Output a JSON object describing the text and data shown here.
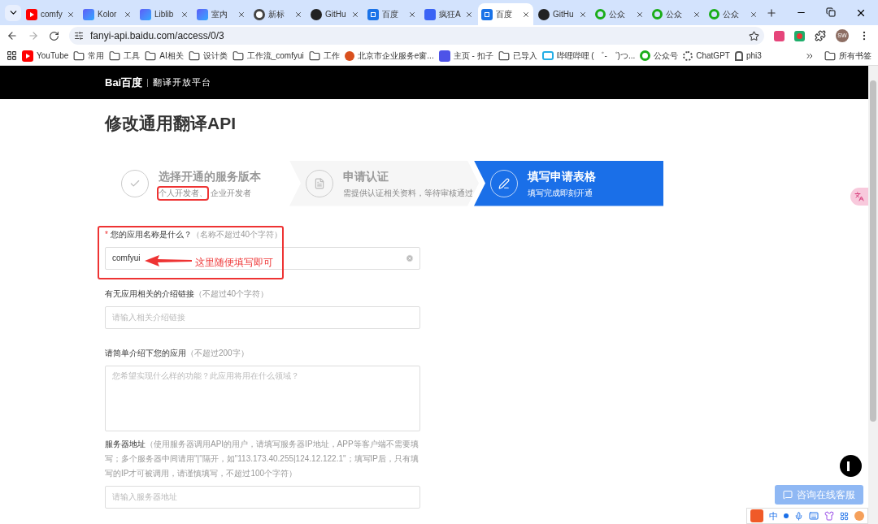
{
  "tabs": [
    {
      "kind": "youtube",
      "title": "comfy",
      "selected": false
    },
    {
      "kind": "ub",
      "title": "Kolor",
      "selected": false
    },
    {
      "kind": "ub",
      "title": "Liblib",
      "selected": false
    },
    {
      "kind": "ub",
      "title": "室内",
      "selected": false
    },
    {
      "kind": "chrome",
      "title": "新标",
      "selected": false
    },
    {
      "kind": "github",
      "title": "GitHu",
      "selected": false
    },
    {
      "kind": "translate",
      "title": "百度",
      "selected": false
    },
    {
      "kind": "kuang",
      "title": "疯狂A",
      "selected": false
    },
    {
      "kind": "translate",
      "title": "百度",
      "selected": true
    },
    {
      "kind": "github",
      "title": "GitHu",
      "selected": false
    },
    {
      "kind": "wechat",
      "title": "公众",
      "selected": false
    },
    {
      "kind": "wechat",
      "title": "公众",
      "selected": false
    },
    {
      "kind": "wechat",
      "title": "公众",
      "selected": false
    }
  ],
  "address": "fanyi-api.baidu.com/access/0/3",
  "profile": "SW",
  "bookmarks": [
    {
      "kind": "youtube",
      "label": "YouTube"
    },
    {
      "kind": "folder",
      "label": "常用"
    },
    {
      "kind": "folder",
      "label": "工具"
    },
    {
      "kind": "folder",
      "label": "AI相关"
    },
    {
      "kind": "folder",
      "label": "设计类"
    },
    {
      "kind": "folder",
      "label": "工作流_comfyui"
    },
    {
      "kind": "folder",
      "label": "工作"
    },
    {
      "kind": "gov",
      "label": "北京市企业服务e窗..."
    },
    {
      "kind": "kouzi",
      "label": "主页 - 扣子"
    },
    {
      "kind": "folder",
      "label": "已导入"
    },
    {
      "kind": "bili",
      "label": "哔哩哔哩 ( ゜- ゜)つ..."
    },
    {
      "kind": "wechat",
      "label": "公众号"
    },
    {
      "kind": "gpt",
      "label": "ChatGPT"
    },
    {
      "kind": "robot",
      "label": "phi3"
    }
  ],
  "all_bookmarks": "所有书签",
  "site": {
    "logo": "Bai百度",
    "platform": "翻译开放平台"
  },
  "page_title": "修改通用翻译API",
  "steps": [
    {
      "kind": "check",
      "title": "选择开通的服务版本",
      "subtitle": [
        {
          "text": "个人开发者、",
          "highlighted": true
        },
        {
          "text": "企业开发者",
          "highlighted": false
        }
      ],
      "selected": false
    },
    {
      "kind": "doc",
      "title": "申请认证",
      "subtitle": [
        {
          "text": "需提供认证相关资料，等待审核通过",
          "highlighted": false
        }
      ],
      "selected": false
    },
    {
      "kind": "pen",
      "title": "填写申请表格",
      "subtitle": [
        {
          "text": "填写完成即刻开通",
          "highlighted": false
        }
      ],
      "selected": true
    }
  ],
  "fields": [
    {
      "marker": "*",
      "label": "您的应用名称是什么？",
      "hint": "（名称不超过40个字符）",
      "kind": "input",
      "value": "comfyui"
    },
    {
      "label": "有无应用相关的介绍链接",
      "hint": "（不超过40个字符）",
      "kind": "input",
      "placeholder": "请输入相关介绍链接"
    },
    {
      "label": "请简单介绍下您的应用",
      "hint": "（不超过200字）",
      "kind": "textarea",
      "placeholder": "您希望实现什么样的功能？此应用将用在什么领域？"
    },
    {
      "label": "服务器地址",
      "hint": "（使用服务器调用API的用户，请填写服务器IP地址，APP等客户端不需要填写；多个服务器中间请用\"|\"隔开，如\"113.173.40.255|124.12.122.1\"；填写IP后，只有填写的IP才可被调用，请谨慎填写，不超过100个字符）",
      "kind": "input",
      "placeholder": "请输入服务器地址"
    }
  ],
  "annotation": "这里随便填写即可",
  "consult_button": "咨询在线客服",
  "ime": {
    "mode": "中"
  }
}
